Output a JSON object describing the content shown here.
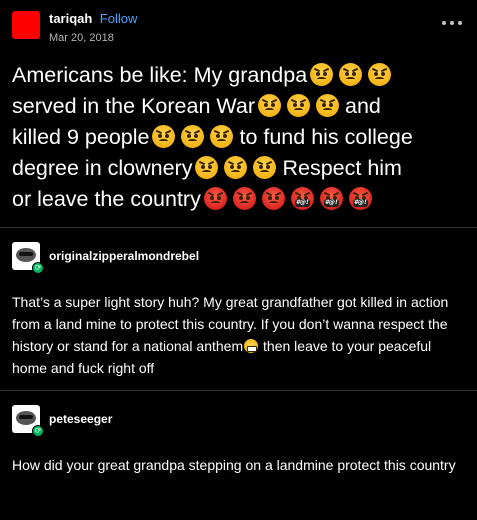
{
  "post": {
    "author": "tariqah",
    "follow_label": "Follow",
    "date": "Mar 20, 2018",
    "line1": "Americans be like: My grandpa",
    "line2a": "served in the Korean War",
    "line2b": "and",
    "line3a": "killed 9 people",
    "line3b": "to fund his college",
    "line4a": "degree in clownery",
    "line4b": "Respect him",
    "line5": "or leave the country",
    "symbols_text": "#@!"
  },
  "reblogs": [
    {
      "username": "originalzipperalmondrebel",
      "text_before_emoji": "That’s a super light story huh? My great grandfather got killed in action from a land mine to protect this country. If you don’t wanna respect the history or stand for a national anthem",
      "text_after_emoji": " then leave to your peaceful home and fuck right off"
    },
    {
      "username": "peteseeger",
      "text": "How did your great grandpa stepping on a landmine protect this country"
    }
  ],
  "colors": {
    "background": "#000000",
    "link": "#4aa3ff",
    "avatar_main": "#ff0000",
    "reblog_badge": "#00b85c"
  },
  "icons": {
    "angry_face": "angry-face-icon",
    "pouting_face": "pouting-face-icon",
    "symbols_face": "face-with-symbols-on-mouth-icon",
    "grin_face": "grimacing-face-icon",
    "more": "more-options-icon",
    "reblog": "reblog-icon"
  }
}
